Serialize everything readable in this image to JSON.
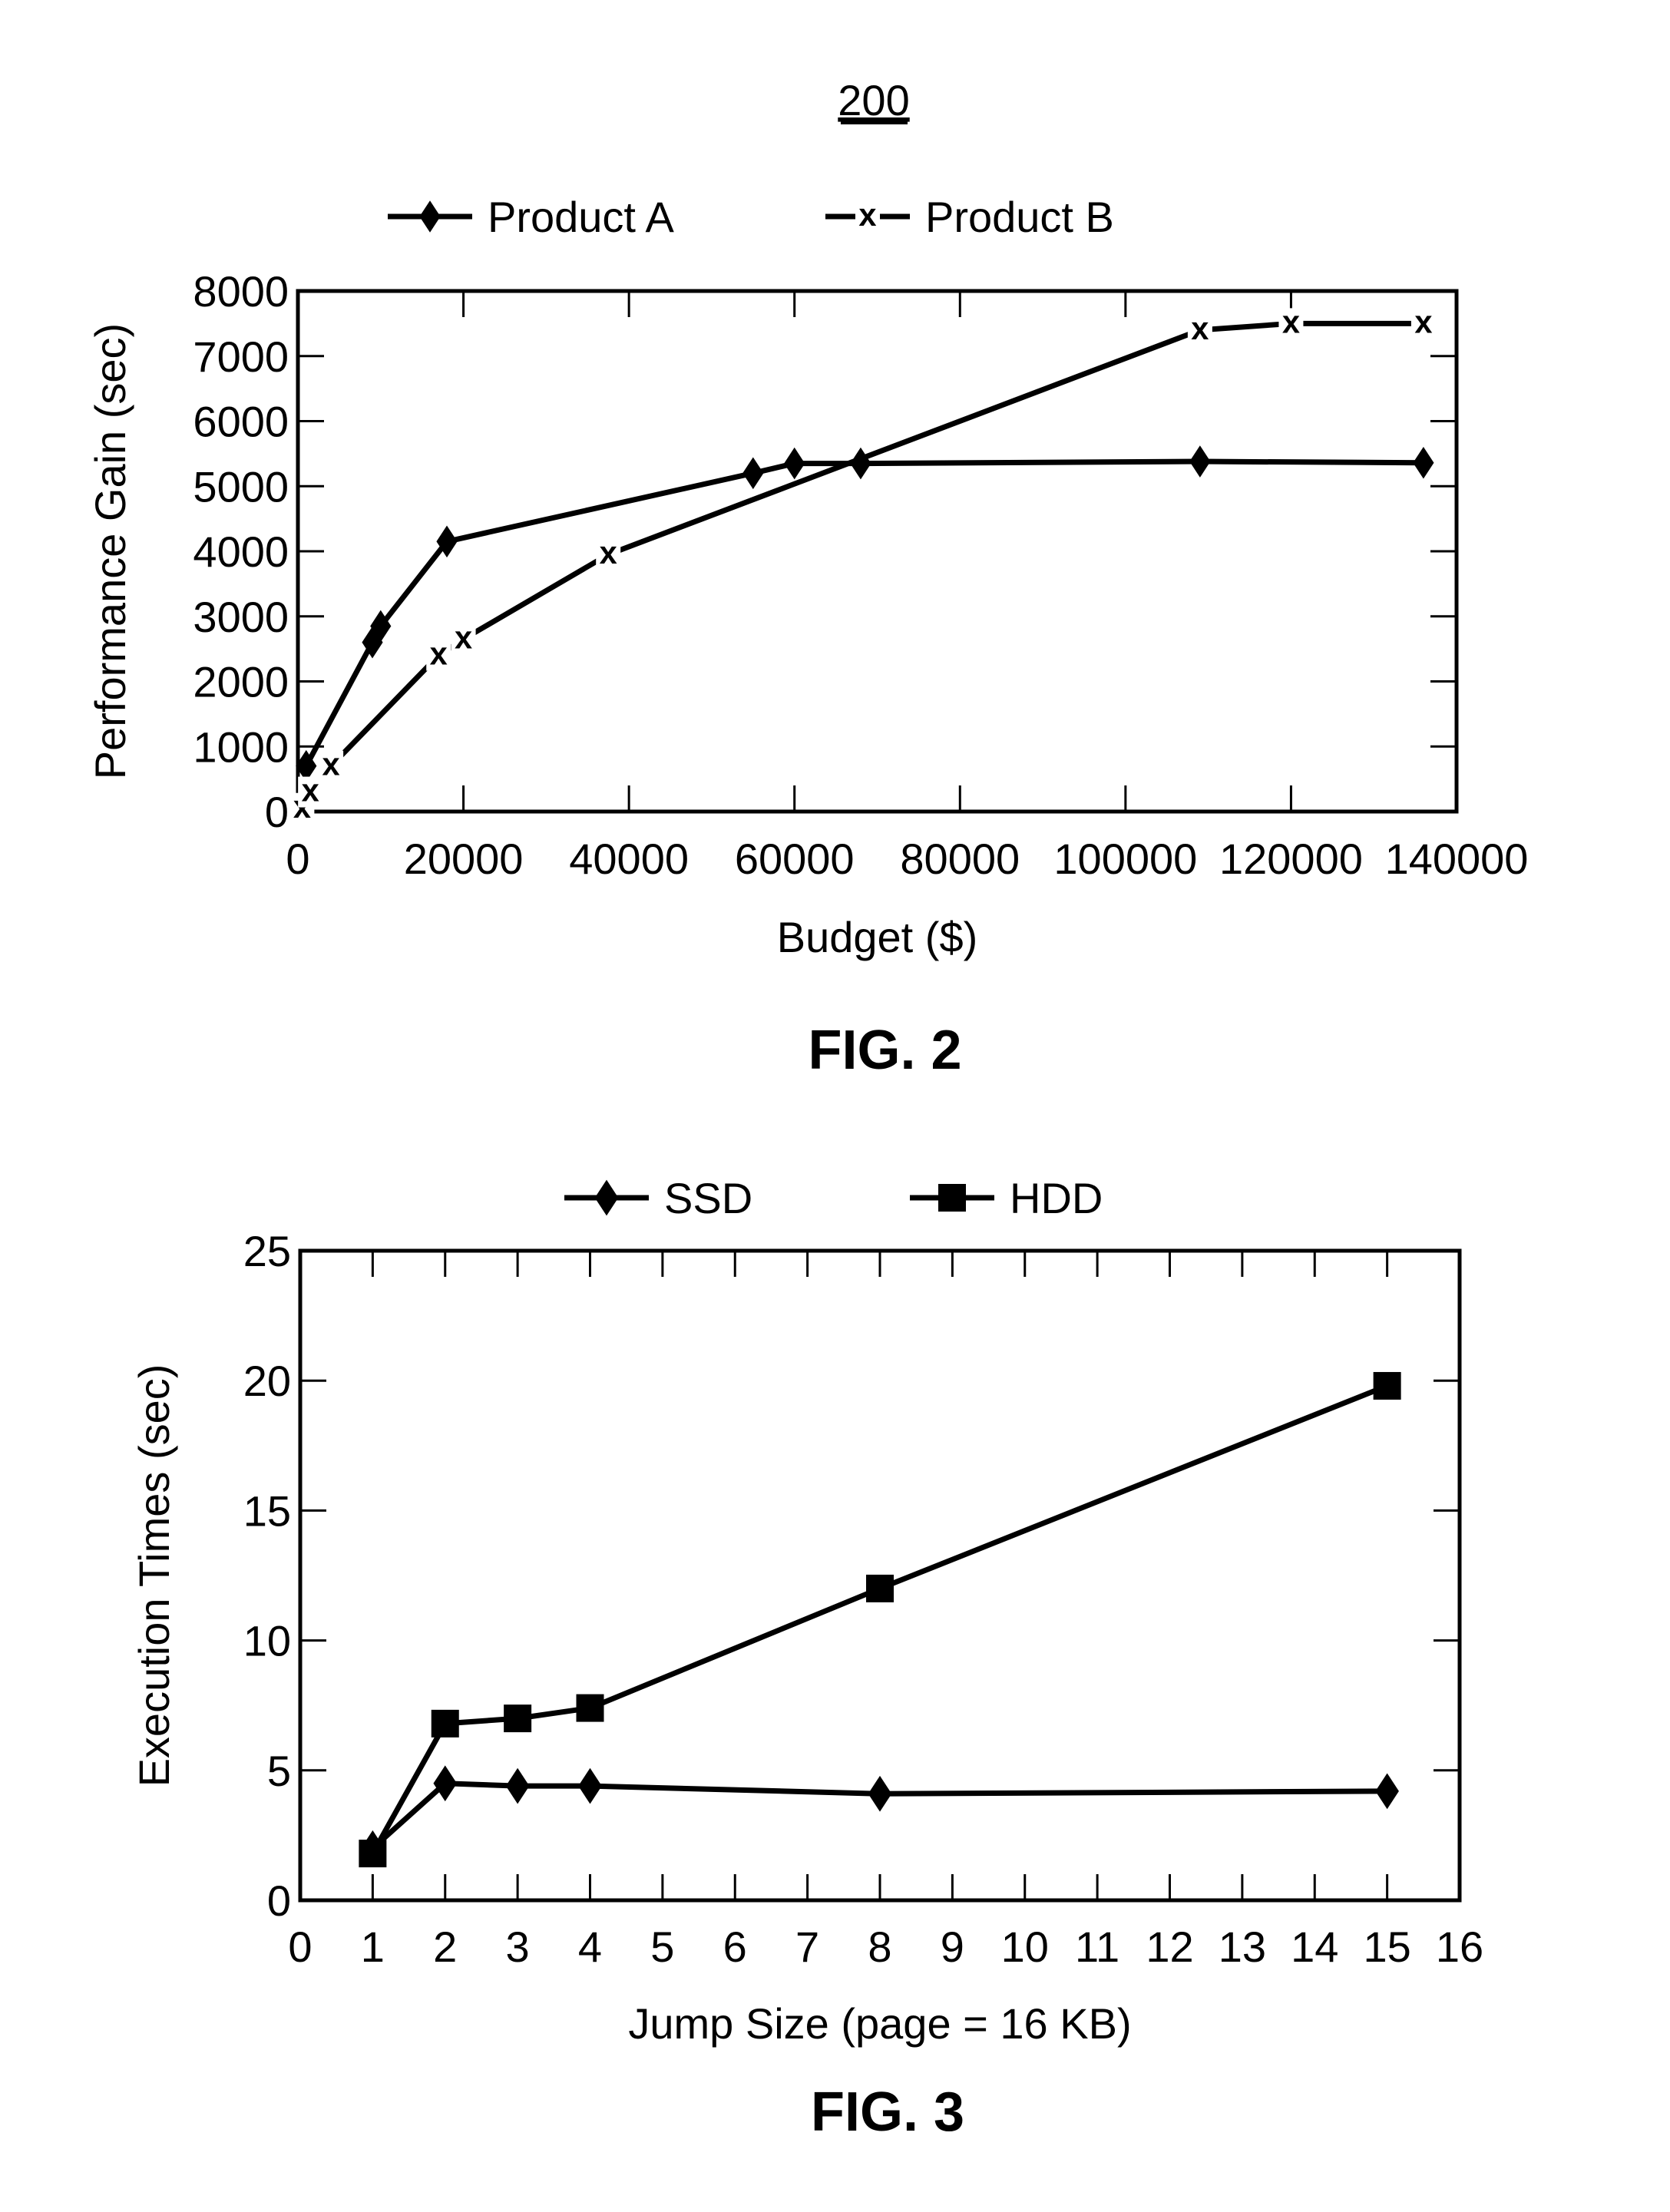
{
  "figure_number": "200",
  "chart_data": [
    {
      "type": "line",
      "caption": "FIG. 2",
      "xlabel": "Budget ($)",
      "ylabel": "Performance Gain (sec)",
      "xlim": [
        0,
        140000
      ],
      "ylim": [
        0,
        8000
      ],
      "xticks": [
        0,
        20000,
        40000,
        60000,
        80000,
        100000,
        120000,
        140000
      ],
      "yticks": [
        0,
        1000,
        2000,
        3000,
        4000,
        5000,
        6000,
        7000,
        8000
      ],
      "grid": false,
      "legend_position": "top-center",
      "series": [
        {
          "name": "Product A",
          "marker": "diamond",
          "x": [
            1000,
            9000,
            10000,
            18000,
            55000,
            60000,
            68000,
            109000,
            136000
          ],
          "y": [
            700,
            2600,
            2850,
            4150,
            5200,
            5350,
            5350,
            5380,
            5360
          ]
        },
        {
          "name": "Product B",
          "marker": "x",
          "x": [
            500,
            1500,
            4000,
            17000,
            20000,
            37500,
            109000,
            120000,
            136000
          ],
          "y": [
            50,
            300,
            700,
            2400,
            2650,
            3950,
            7400,
            7500,
            7500
          ]
        }
      ]
    },
    {
      "type": "line",
      "caption": "FIG. 3",
      "xlabel": "Jump Size (page = 16 KB)",
      "ylabel": "Execution Times (sec)",
      "xlim": [
        0,
        16
      ],
      "ylim": [
        0,
        25
      ],
      "xticks": [
        0,
        1,
        2,
        3,
        4,
        5,
        6,
        7,
        8,
        9,
        10,
        11,
        12,
        13,
        14,
        15,
        16
      ],
      "yticks": [
        0,
        5,
        10,
        15,
        20,
        25
      ],
      "grid": false,
      "legend_position": "top-center",
      "series": [
        {
          "name": "SSD",
          "marker": "diamond",
          "x": [
            1,
            2,
            3,
            4,
            8,
            15
          ],
          "y": [
            2.0,
            4.5,
            4.4,
            4.4,
            4.1,
            4.2
          ]
        },
        {
          "name": "HDD",
          "marker": "square",
          "x": [
            1,
            2,
            3,
            4,
            8,
            15
          ],
          "y": [
            1.8,
            6.8,
            7.0,
            7.4,
            12.0,
            19.8
          ]
        }
      ]
    }
  ]
}
